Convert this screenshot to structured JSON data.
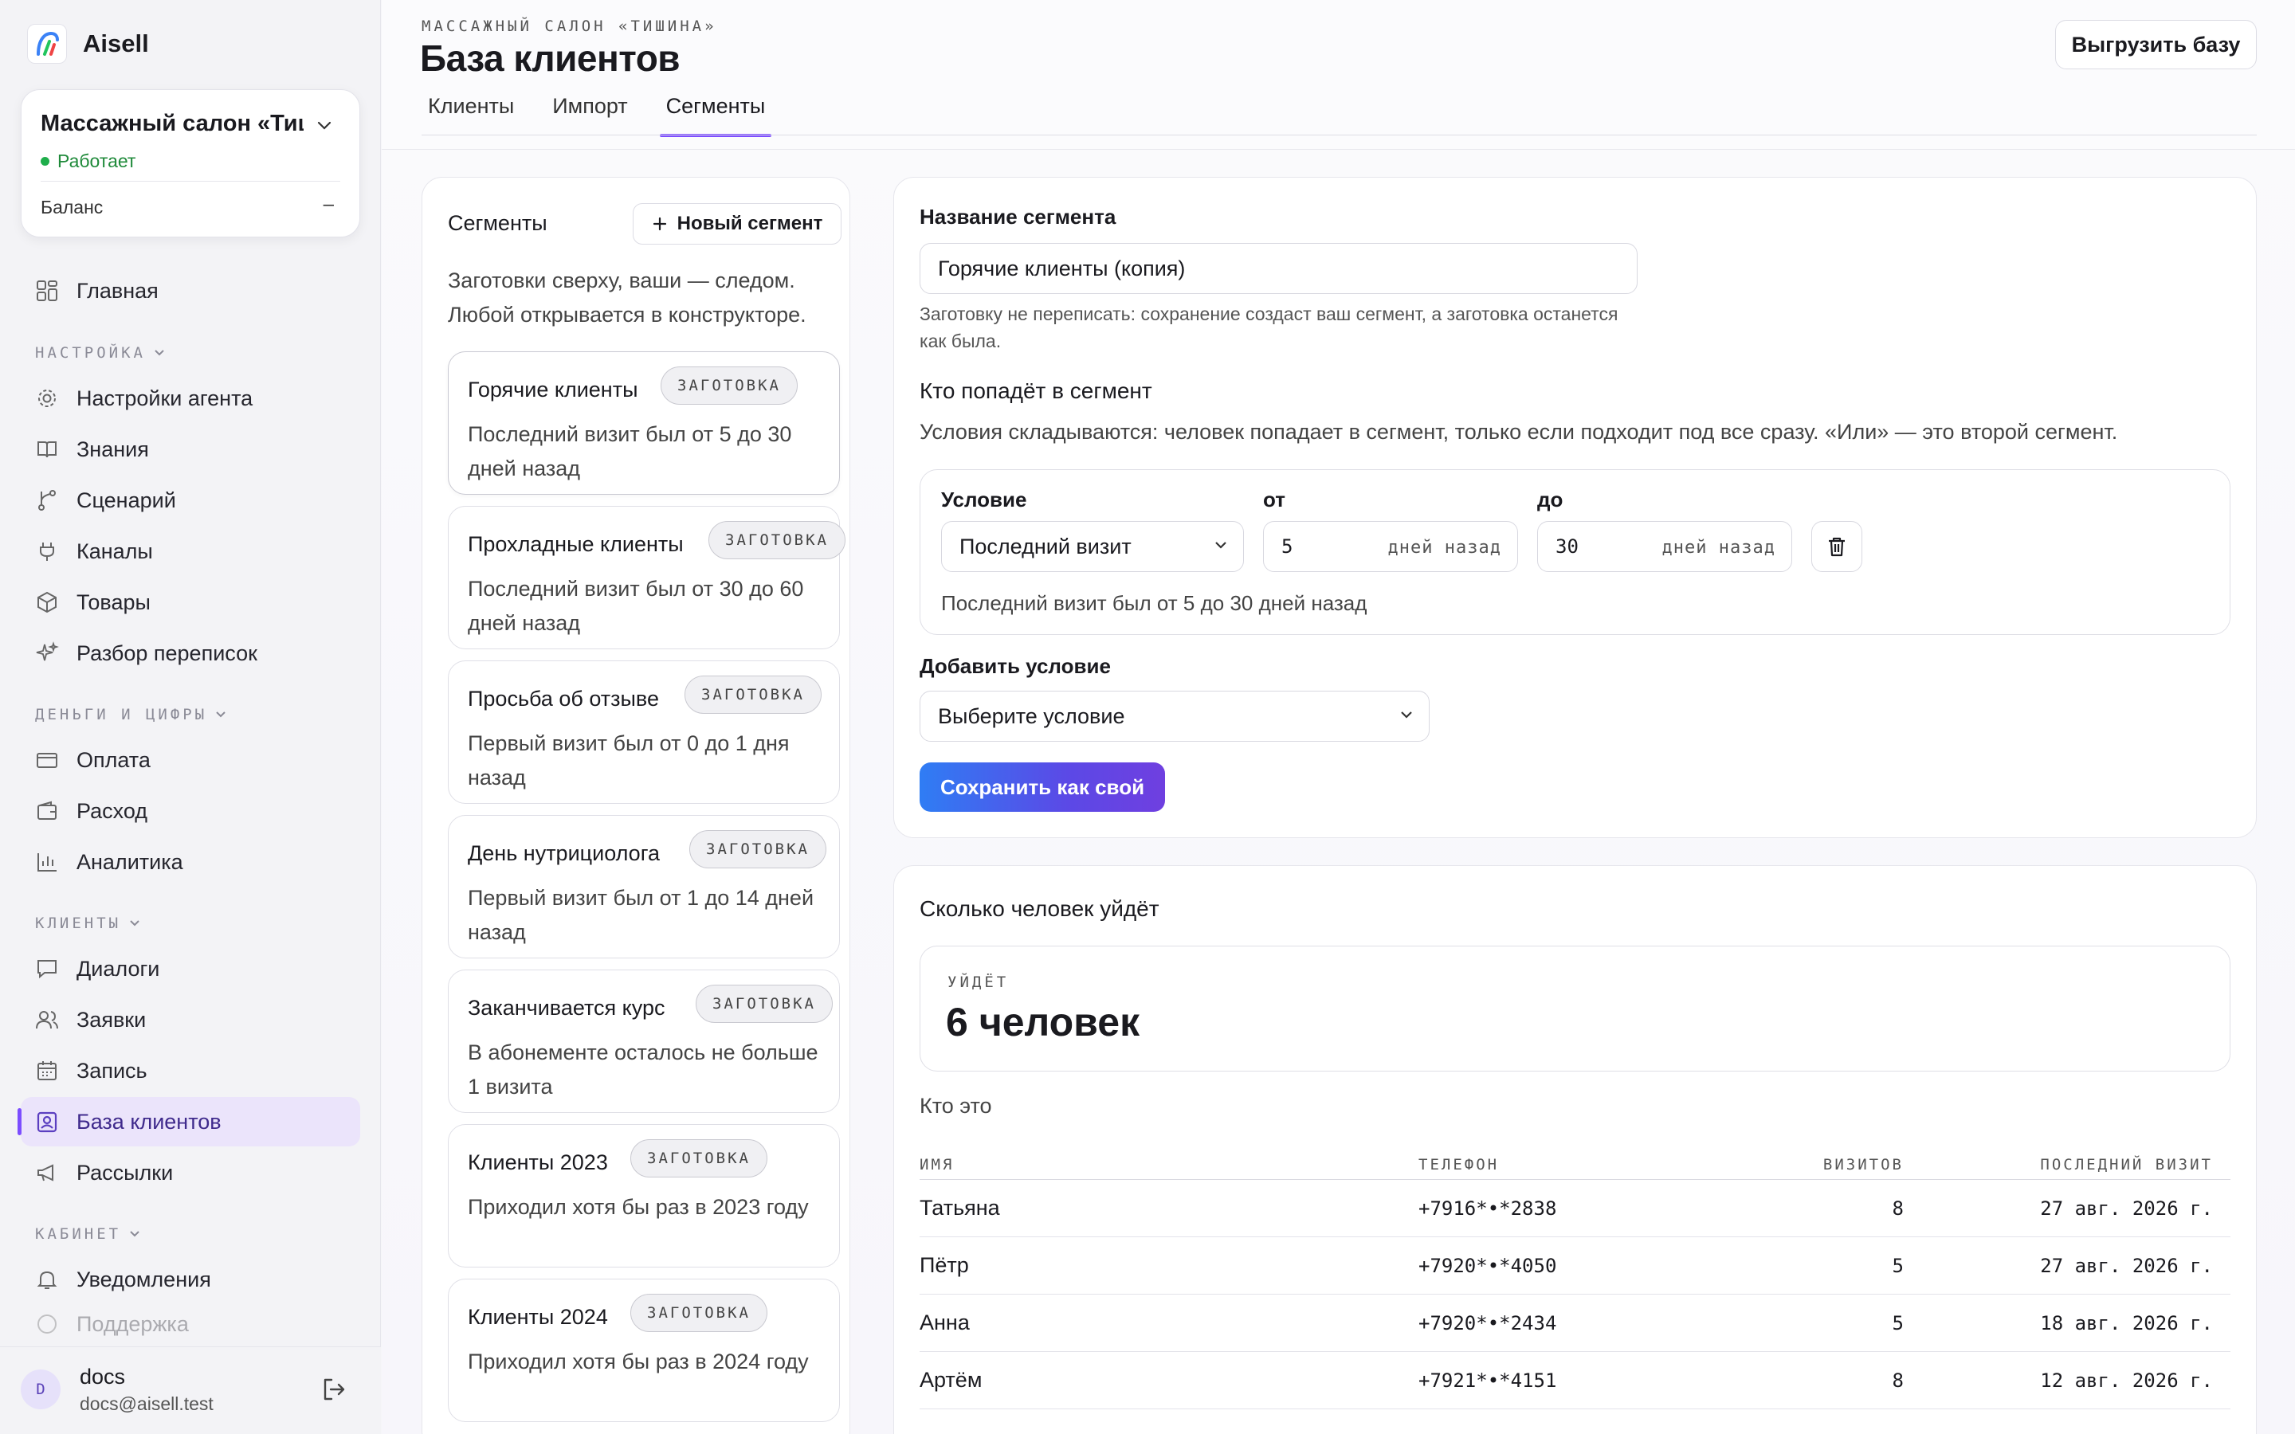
{
  "brand": {
    "name": "Aisell"
  },
  "org": {
    "name": "Массажный салон «Тиш…",
    "status": "Работает",
    "balance_label": "Баланс",
    "balance_value": "–"
  },
  "nav": {
    "home": "Главная",
    "section_settings": "НАСТРОЙКА",
    "agent_settings": "Настройки агента",
    "knowledge": "Знания",
    "scenario": "Сценарий",
    "channels": "Каналы",
    "products": "Товары",
    "chat_review": "Разбор переписок",
    "section_money": "ДЕНЬГИ И ЦИФРЫ",
    "payment": "Оплата",
    "expense": "Расход",
    "analytics": "Аналитика",
    "section_clients": "КЛИЕНТЫ",
    "dialogs": "Диалоги",
    "requests": "Заявки",
    "booking": "Запись",
    "client_base": "База клиентов",
    "mailings": "Рассылки",
    "section_cabinet": "КАБИНЕТ",
    "notifications": "Уведомления",
    "support": "Поддержка"
  },
  "user": {
    "initial": "D",
    "name": "docs",
    "email": "docs@aisell.test"
  },
  "header": {
    "eyebrow": "МАССАЖНЫЙ САЛОН «ТИШИНА»",
    "title": "База клиентов",
    "export_label": "Выгрузить базу",
    "tabs": [
      "Клиенты",
      "Импорт",
      "Сегменты"
    ]
  },
  "segments": {
    "title": "Сегменты",
    "new_button": "Новый сегмент",
    "subtitle": "Заготовки сверху, ваши — следом. Любой открывается в конструкторе.",
    "badge": "ЗАГОТОВКА",
    "items": [
      {
        "title": "Горячие клиенты",
        "desc": "Последний визит был от 5 до 30 дней назад"
      },
      {
        "title": "Прохладные клиенты",
        "desc": "Последний визит был от 30 до 60 дней назад"
      },
      {
        "title": "Просьба об отзыве",
        "desc": "Первый визит был от 0 до 1 дня назад"
      },
      {
        "title": "День нутрициолога",
        "desc": "Первый визит был от 1 до 14 дней назад"
      },
      {
        "title": "Заканчивается курс",
        "desc": "В абонементе осталось не больше 1 визита"
      },
      {
        "title": "Клиенты 2023",
        "desc": "Приходил хотя бы раз в 2023 году"
      },
      {
        "title": "Клиенты 2024",
        "desc": "Приходил хотя бы раз в 2024 году"
      }
    ]
  },
  "editor": {
    "name_label": "Название сегмента",
    "name_value": "Горячие клиенты (копия)",
    "hint": "Заготовку не переписать: сохранение создаст ваш сегмент, а заготовка останется как была.",
    "who_title": "Кто попадёт в сегмент",
    "who_desc": "Условия складываются: человек попадает в сегмент, только если подходит под все сразу. «Или» — это второй сегмент.",
    "condition": {
      "label_condition": "Условие",
      "label_from": "от",
      "label_to": "до",
      "field": "Последний визит",
      "from_value": "5",
      "to_value": "30",
      "suffix": "дней назад",
      "summary": "Последний визит был от 5 до 30 дней назад"
    },
    "add_label": "Добавить условие",
    "add_placeholder": "Выберите условие",
    "save_label": "Сохранить как свой"
  },
  "audience": {
    "title": "Сколько человек уйдёт",
    "count_label": "УЙДЁТ",
    "count_value": "6 человек",
    "who_label": "Кто это",
    "columns": [
      "ИМЯ",
      "ТЕЛЕФОН",
      "ВИЗИТОВ",
      "ПОСЛЕДНИЙ ВИЗИТ"
    ],
    "rows": [
      {
        "name": "Татьяна",
        "phone": "+7916*•*2838",
        "visits": "8",
        "last": "27 авг. 2026 г."
      },
      {
        "name": "Пётр",
        "phone": "+7920*•*4050",
        "visits": "5",
        "last": "27 авг. 2026 г."
      },
      {
        "name": "Анна",
        "phone": "+7920*•*2434",
        "visits": "5",
        "last": "18 авг. 2026 г."
      },
      {
        "name": "Артём",
        "phone": "+7921*•*4151",
        "visits": "8",
        "last": "12 авг. 2026 г."
      }
    ]
  },
  "colors": {
    "accent": "#7c4dff",
    "status_green": "#1fae4b",
    "save_gradient_start": "#2f7df4",
    "save_gradient_end": "#6f3fe0"
  }
}
